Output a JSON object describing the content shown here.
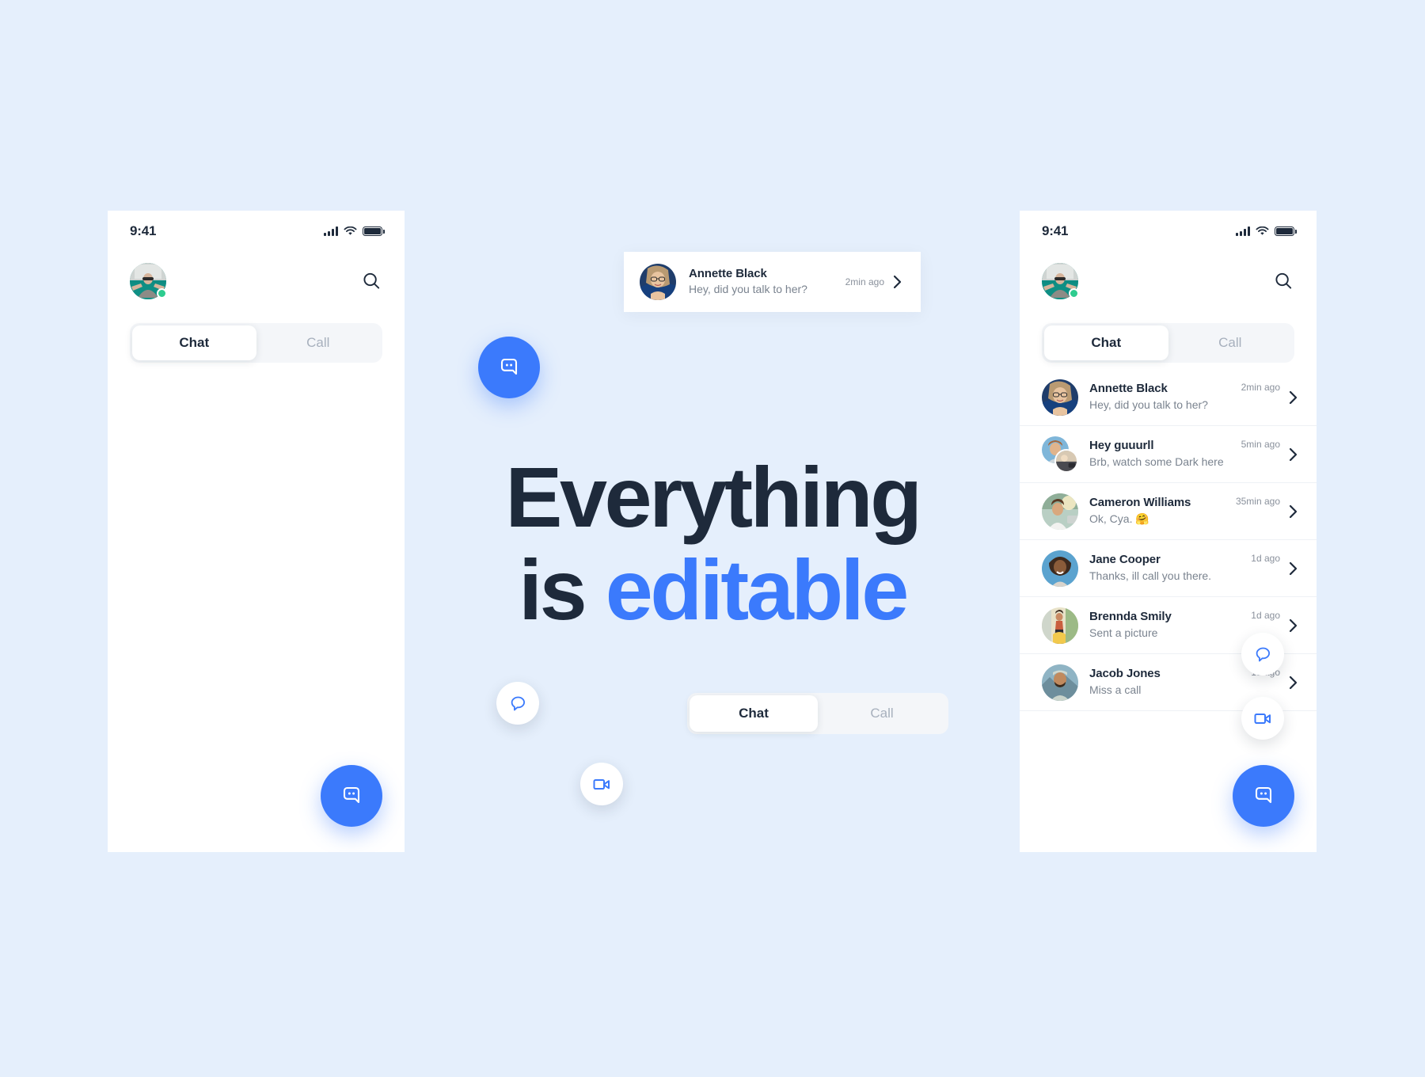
{
  "theme": {
    "background": "#e5effc",
    "accent": "#3b7afc",
    "text_dark": "#1e2a3b",
    "text_muted": "#7a838f",
    "online": "#2ecc8f",
    "surface": "#ffffff",
    "tab_track": "#f4f6f9"
  },
  "status_bar": {
    "time": "9:41",
    "icons": [
      "cellular-signal-icon",
      "wifi-icon",
      "battery-icon"
    ]
  },
  "app_header": {
    "avatar_name": "user-avatar",
    "online": true,
    "search_icon": "search-icon"
  },
  "tabs": {
    "chat_label": "Chat",
    "call_label": "Call",
    "active": "Chat"
  },
  "headline": {
    "line1": "Everything",
    "line2_prefix": "is ",
    "line2_accent": "editable"
  },
  "notification_card": {
    "name": "Annette Black",
    "message": "Hey, did you talk to her?",
    "time": "2min ago",
    "chevron": "chevron-right-icon"
  },
  "chats": [
    {
      "name": "Annette Black",
      "message": "Hey, did you talk to her?",
      "time": "2min ago",
      "avatar": "annette-avatar",
      "dual": false
    },
    {
      "name": "Hey guuurll",
      "message": "Brb, watch some Dark here",
      "time": "5min ago",
      "avatar": "group-avatar",
      "dual": true
    },
    {
      "name": "Cameron Williams",
      "message": "Ok, Cya. 🤗",
      "time": "35min ago",
      "avatar": "cameron-avatar",
      "dual": false
    },
    {
      "name": "Jane Cooper",
      "message": "Thanks, ill call you there.",
      "time": "1d ago",
      "avatar": "jane-avatar",
      "dual": false
    },
    {
      "name": "Brennda Smily",
      "message": "Sent a picture",
      "time": "1d ago",
      "avatar": "brennda-avatar",
      "dual": false
    },
    {
      "name": "Jacob Jones",
      "message": "Miss a call",
      "time": "1d ago",
      "avatar": "jacob-avatar",
      "dual": false
    }
  ],
  "floating_buttons": {
    "primary_icon": "chat-bubble-dots-icon",
    "message_icon": "message-bubble-icon",
    "video_icon": "video-camera-icon"
  }
}
